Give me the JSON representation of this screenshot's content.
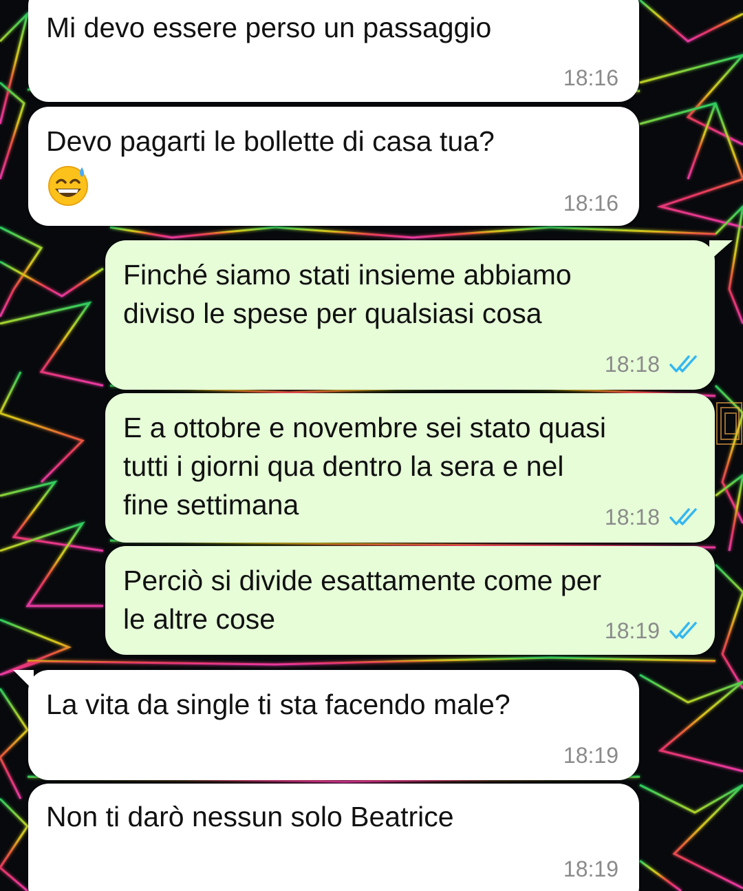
{
  "messages": [
    {
      "direction": "incoming",
      "text": "Mi devo essere perso un passaggio",
      "time": "18:16"
    },
    {
      "direction": "incoming",
      "text": "Devo pagarti le bollette di casa tua?",
      "emoji": "grinning-face-with-sweat",
      "time": "18:16"
    },
    {
      "direction": "outgoing",
      "text": "Finché siamo stati insieme abbiamo\ndiviso le spese per qualsiasi cosa",
      "time": "18:18",
      "status": "read"
    },
    {
      "direction": "outgoing",
      "text": "E a ottobre e novembre sei stato quasi\ntutti i giorni qua dentro la sera e nel\nfine settimana",
      "time": "18:18",
      "status": "read"
    },
    {
      "direction": "outgoing",
      "text": "Perciò si divide esattamente come per\nle altre cose",
      "time": "18:19",
      "status": "read"
    },
    {
      "direction": "incoming",
      "text": "La vita da single ti sta facendo male?",
      "time": "18:19"
    },
    {
      "direction": "incoming",
      "text": "Non ti darò nessun solo Beatrice",
      "time": "18:19"
    }
  ],
  "colors": {
    "incoming_bubble": "#ffffff",
    "outgoing_bubble": "#e6fdd8",
    "timestamp": "#8a8a8a",
    "read_ticks": "#34b7f1",
    "wallpaper": "#07090c"
  },
  "wallpaper": "neon-geometric-lines",
  "icons": {
    "status_read": "double-check-icon"
  }
}
